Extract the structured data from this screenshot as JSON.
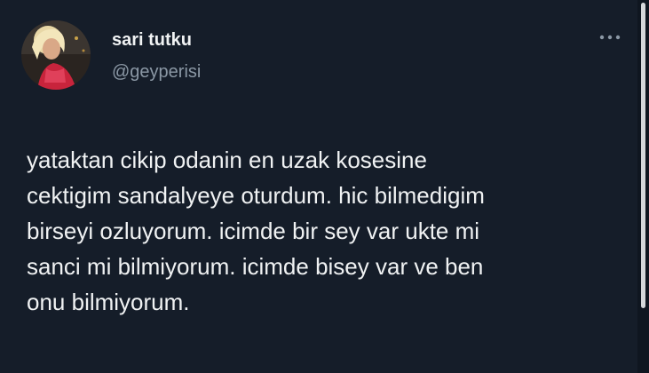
{
  "tweet": {
    "author": {
      "name": "sari tutku",
      "handle": "@geyperisi"
    },
    "text_lines": [
      "yataktan cikip odanin en uzak kosesine",
      "cektigim sandalyeye oturdum. hic bilmedigim",
      "birseyi ozluyorum. icimde bir sey var ukte mi",
      "sanci mi bilmiyorum. icimde bisey var ve ben",
      "onu bilmiyorum."
    ]
  },
  "icons": {
    "avatar": "profile-photo",
    "more": "more-options-icon"
  },
  "colors": {
    "background": "#151d29",
    "text": "#e7e9ea",
    "secondary_text": "#8b98a5"
  }
}
